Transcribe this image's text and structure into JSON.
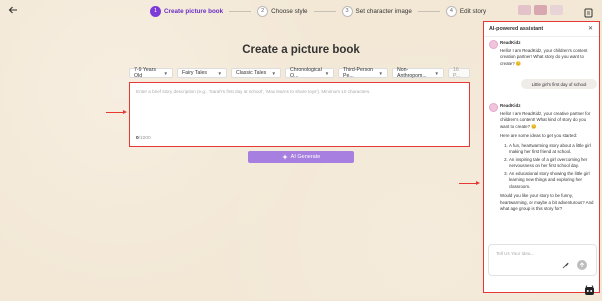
{
  "topbar": {
    "back_icon": "arrow-left-icon",
    "steps": [
      {
        "num": "1",
        "label": "Create picture book",
        "active": true
      },
      {
        "num": "2",
        "label": "Choose style",
        "active": false
      },
      {
        "num": "3",
        "label": "Set character image",
        "active": false
      },
      {
        "num": "4",
        "label": "Edit story",
        "active": false
      }
    ]
  },
  "main": {
    "title": "Create a picture book",
    "options": [
      {
        "label": "7-9 Years Old"
      },
      {
        "label": "Fairy Tales"
      },
      {
        "label": "Classic Tales"
      },
      {
        "label": "Chronological O..."
      },
      {
        "label": "Third-Person Pe..."
      },
      {
        "label": "Non-Anthropom..."
      }
    ],
    "extra_option": "16 P...",
    "description_placeholder": "Enter a brief story description (e.g., 'Sarah's first day at school', 'Max learns to share toys'). Minimum 10 characters.",
    "char_count": "0",
    "char_limit": "/1000",
    "generate_label": "AI Generate"
  },
  "assistant": {
    "title": "AI-powered assistant",
    "close_icon": "close-icon",
    "messages": [
      {
        "sender": "ReadKidz",
        "text": "Hello! I am ReadKidz, your children's content creation partner! What story do you want to create? 😊"
      },
      {
        "sender": "user",
        "text": "Little girl's first day of school"
      },
      {
        "sender": "ReadKidz",
        "intro": "Hello! I am ReadKidz, your creative partner for children's content! What kind of story do you want to create? 😊",
        "ideas_lead": "Here are some ideas to get you started:",
        "ideas": [
          "A fun, heartwarming story about a little girl making her first friend at school.",
          "An inspiring tale of a girl overcoming her nervousness on her first school day.",
          "An educational story showing the little girl learning new things and exploring her classroom."
        ],
        "question": "Would you like your story to be funny, heartwarming, or maybe a bit adventurous? And what age group is this story for?"
      }
    ],
    "input_placeholder": "Tell Us Your Idea..."
  }
}
